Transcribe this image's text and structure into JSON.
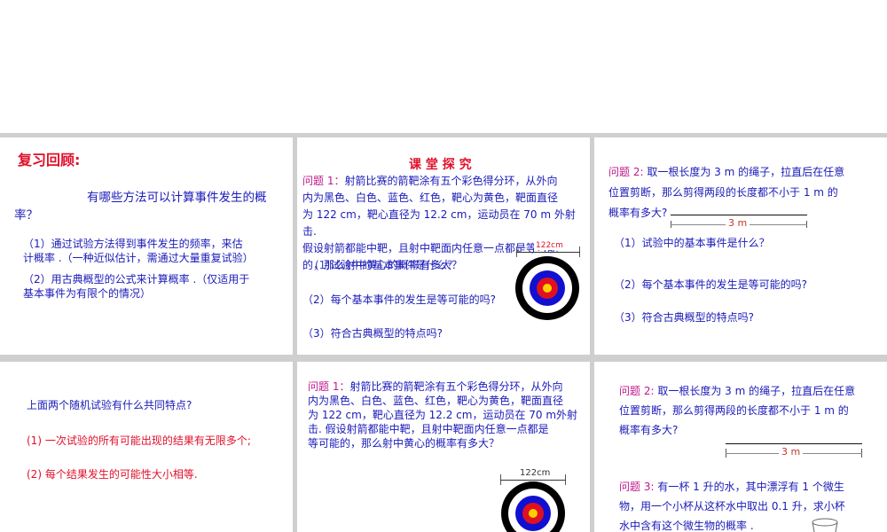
{
  "p1": {
    "title": "复习回顾:",
    "question": "有哪些方法可以计算事件发生的概率？",
    "item1_l1": "（1）通过试验方法得到事件发生的频率，来估",
    "item1_l2": "计概率 .（一种近似估计，需通过大量重复试验）",
    "item2_l1": "（2）用古典概型的公式来计算概率 .（仅适用于",
    "item2_l2": "基本事件为有限个的情况）"
  },
  "p2": {
    "title": "课 堂 探 究",
    "q_label": "问题 1：",
    "q_l1": "射箭比赛的箭靶涂有五个彩色得分环，从外向",
    "q_l2": "内为黑色、白色、蓝色、红色，靶心为黄色，靶面直径",
    "q_l3": "为 122 cm，靶心直径为 12.2 cm，运动员在 70 m 外射",
    "q_l4": "击.",
    "q_l5": "假设射箭都能中靶，且射中靶面内任意一点都是等可能",
    "q_l6": "的，那么射中黄心的概率有多大？",
    "q_overlap": "(1)试验中的基本事件是什么？",
    "target_label": "122cm",
    "sub2": "（2）每个基本事件的发生是等可能的吗?",
    "sub3": "（3）符合古典概型的特点吗?"
  },
  "p3": {
    "q_label": "问题 2:",
    "q_l1": " 取一根长度为 3 m 的绳子，拉直后在任意",
    "q_l2": "位置剪断，那么剪得两段的长度都不小于 1 m 的",
    "q_l3": "概率有多大?",
    "rope_label": "3 m",
    "sub1": "（1）试验中的基本事件是什么？",
    "sub2": "（2）每个基本事件的发生是等可能的吗?",
    "sub3": "（3）符合古典概型的特点吗?"
  },
  "p4": {
    "question": "上面两个随机试验有什么共同特点?",
    "point1": "(1) 一次试验的所有可能出现的结果有无限多个;",
    "point2": "(2)  每个结果发生的可能性大小相等."
  },
  "p5": {
    "q_label": "问题 1：",
    "q_l1": "射箭比赛的箭靶涂有五个彩色得分环，从外向",
    "q_l2": "内为黑色、白色、蓝色、红色，靶心为黄色，靶面直径",
    "q_l3": "为 122 cm，靶心直径为 12.2 cm，运动员在 70 m外射",
    "q_l4": "击. 假设射箭都能中靶，且射中靶面内任意一点都是",
    "q_l5": "等可能的，那么射中黄心的概率有多大？",
    "target_label": "122cm"
  },
  "p6": {
    "q2_label": "问题 2:",
    "q2_l1": " 取一根长度为 3 m 的绳子，拉直后在任意",
    "q2_l2": "位置剪断，那么剪得两段的长度都不小于 1 m 的",
    "q2_l3": "概率有多大?",
    "rope_label": "3 m",
    "q3_label": "问题 3:",
    "q3_l1": "  有一杯 1 升的水，其中漂浮有 1 个微生",
    "q3_l2": "物，用一个小杯从这杯水中取出 0.1 升，求小杯",
    "q3_l3": "水中含有这个微生物的概率 ."
  },
  "colors": {
    "band": "#cfcfcf",
    "blue_text": "#1a1ab8",
    "red_text": "#e0102a",
    "magenta_label": "#c0188c",
    "rope_label": "#c0392b"
  }
}
